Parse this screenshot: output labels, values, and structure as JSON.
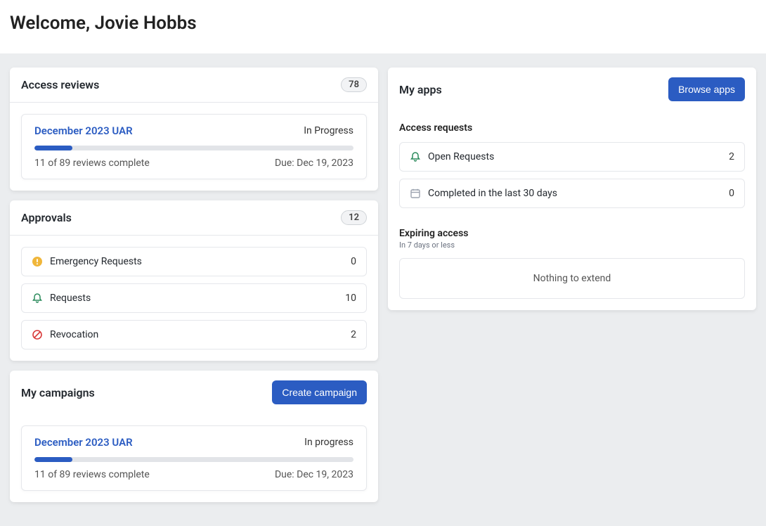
{
  "header": {
    "welcome": "Welcome, Jovie Hobbs"
  },
  "accessReviews": {
    "title": "Access reviews",
    "count": "78",
    "campaign": {
      "name": "December 2023 UAR",
      "status": "In Progress",
      "progressPct": 12,
      "completed": "11 of 89 reviews complete",
      "due": "Due: Dec 19, 2023"
    }
  },
  "approvals": {
    "title": "Approvals",
    "count": "12",
    "items": [
      {
        "label": "Emergency Requests",
        "value": "0"
      },
      {
        "label": "Requests",
        "value": "10"
      },
      {
        "label": "Revocation",
        "value": "2"
      }
    ]
  },
  "myCampaigns": {
    "title": "My campaigns",
    "cta": "Create campaign",
    "campaign": {
      "name": "December 2023 UAR",
      "status": "In progress",
      "progressPct": 12,
      "completed": "11 of 89 reviews complete",
      "due": "Due: Dec 19, 2023"
    }
  },
  "myApps": {
    "title": "My apps",
    "cta": "Browse apps",
    "accessRequests": {
      "title": "Access requests",
      "items": [
        {
          "label": "Open Requests",
          "value": "2"
        },
        {
          "label": "Completed in the last 30 days",
          "value": "0"
        }
      ]
    },
    "expiring": {
      "title": "Expiring access",
      "sub": "In 7 days or less",
      "empty": "Nothing to extend"
    }
  }
}
